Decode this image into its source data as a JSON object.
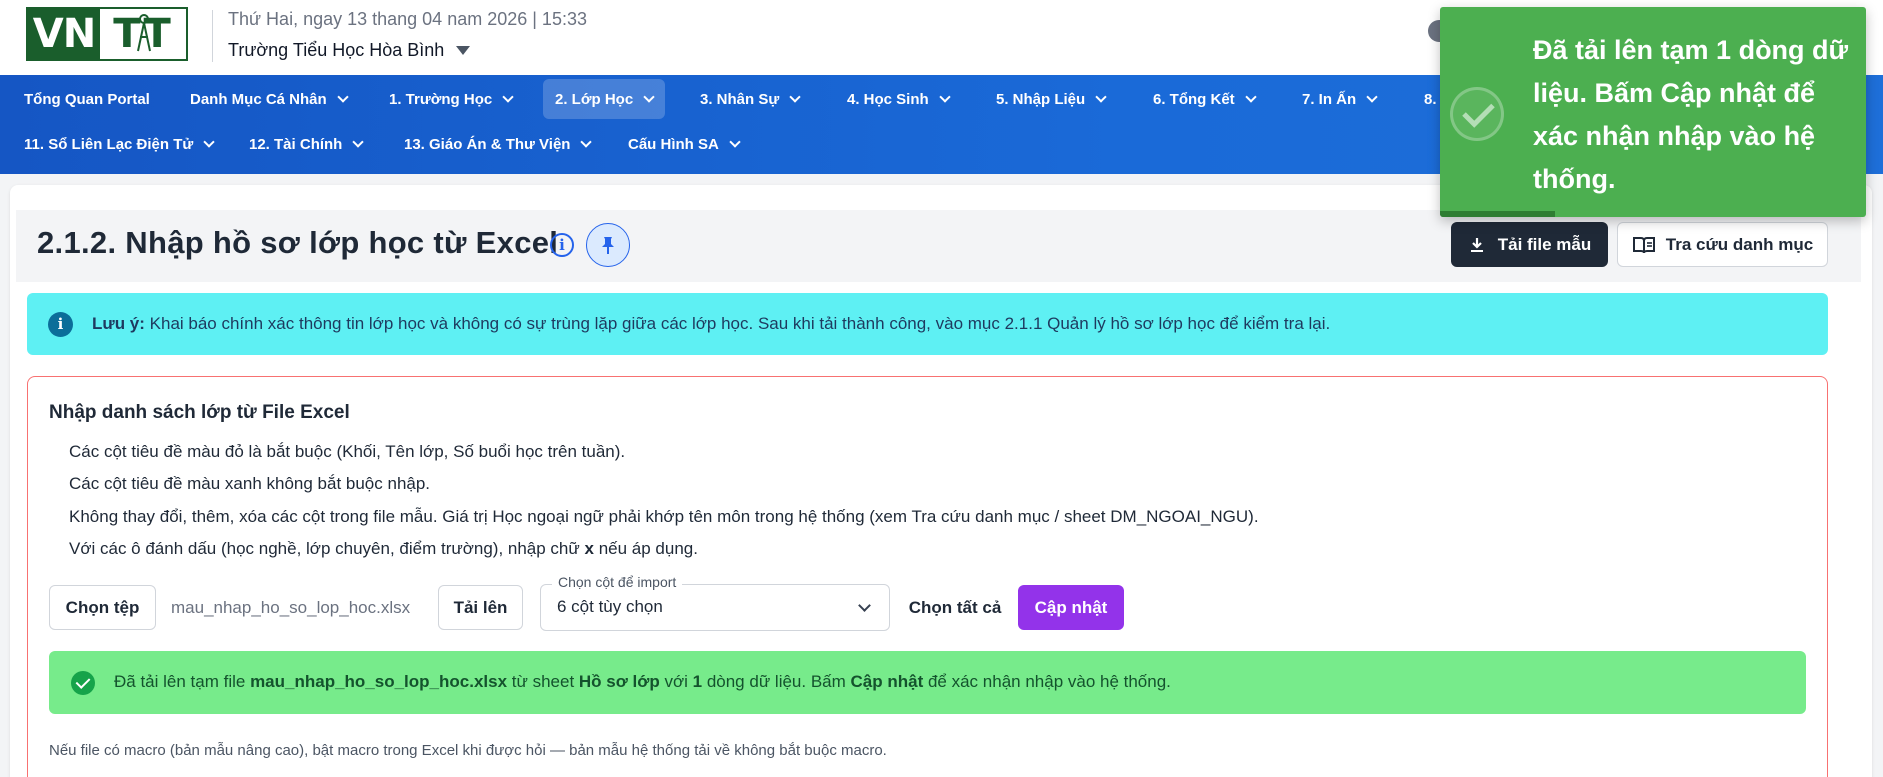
{
  "header": {
    "logo_text_left": "VN",
    "logo_text_right": "TT",
    "datetime": "Thứ Hai, ngay 13 thang 04 nam 2026 | 15:33",
    "school": "Trường Tiểu Học Hòa Bình"
  },
  "nav": {
    "row1": [
      {
        "label": "Tổng Quan Portal",
        "chevron": false
      },
      {
        "label": "Danh Mục Cá Nhân",
        "chevron": true
      },
      {
        "label": "1. Trường Học",
        "chevron": true
      },
      {
        "label": "2. Lớp Học",
        "chevron": true,
        "active": true
      },
      {
        "label": "3. Nhân Sự",
        "chevron": true
      },
      {
        "label": "4. Học Sinh",
        "chevron": true
      },
      {
        "label": "5. Nhập Liệu",
        "chevron": true
      },
      {
        "label": "6. Tổng Kết",
        "chevron": true
      },
      {
        "label": "7. In Ấn",
        "chevron": true
      },
      {
        "label": "8.",
        "chevron": false
      }
    ],
    "row2": [
      {
        "label": "11. Sổ Liên Lạc Điện Tử",
        "chevron": true
      },
      {
        "label": "12. Tài Chính",
        "chevron": true
      },
      {
        "label": "13. Giáo Án & Thư Viện",
        "chevron": true
      },
      {
        "label": "Cấu Hình SA",
        "chevron": true
      }
    ]
  },
  "page": {
    "title": "2.1.2. Nhập hồ sơ lớp học từ Excel",
    "download_template_label": "Tải file mẫu",
    "lookup_label": "Tra cứu danh mục"
  },
  "info_alert": {
    "prefix": "Lưu ý:",
    "text": " Khai báo chính xác thông tin lớp học và không có sự trùng lặp giữa các lớp học. Sau khi tải thành công, vào mục 2.1.1 Quản lý hồ sơ lớp học để kiểm tra lại."
  },
  "import": {
    "title": "Nhập danh sách lớp từ File Excel",
    "rules": [
      "Các cột tiêu đề màu đỏ là bắt buộc (Khối, Tên lớp, Số buổi học trên tuần).",
      "Các cột tiêu đề màu xanh không bắt buộc nhập.",
      "Không thay đổi, thêm, xóa các cột trong file mẫu. Giá trị Học ngoại ngữ phải khớp tên môn trong hệ thống (xem Tra cứu danh mục / sheet DM_NGOAI_NGU)."
    ],
    "rule4_before": "Với các ô đánh dấu (học nghề, lớp chuyên, điểm trường), nhập chữ ",
    "rule4_bold": "x",
    "rule4_after": " nếu áp dụng.",
    "choose_file_label": "Chọn tệp",
    "file_name": "mau_nhap_ho_so_lop_hoc.xlsx",
    "upload_label": "Tải lên",
    "select_legend": "Chọn cột để import",
    "select_value": "6 cột tùy chọn",
    "select_all_label": "Chọn tất cả",
    "update_label": "Cập nhật",
    "success": {
      "t1": "Đã tải lên tạm file ",
      "file": "mau_nhap_ho_so_lop_hoc.xlsx",
      "t2": " từ sheet ",
      "sheet": "Hồ sơ lớp",
      "t3": " với ",
      "count": "1",
      "t4": " dòng dữ liệu. Bấm ",
      "action": "Cập nhật",
      "t5": " để xác nhận nhập vào hệ thống."
    },
    "macro_note": "Nếu file có macro (bản mẫu nâng cao), bật macro trong Excel khi được hỏi — bản mẫu hệ thống tải về không bắt buộc macro."
  },
  "toast": {
    "message": "Đã tải lên tạm 1 dòng dữ liệu. Bấm Cập nhật để xác nhận nhập vào hệ thống.",
    "progress_fraction": 0.27
  },
  "colors": {
    "nav_bg": "#1a6ad8",
    "info_alert_bg": "#5ef0f3",
    "success_bg": "#77eb8b",
    "update_button": "#9333ea",
    "toast_bg": "#4caf50"
  }
}
